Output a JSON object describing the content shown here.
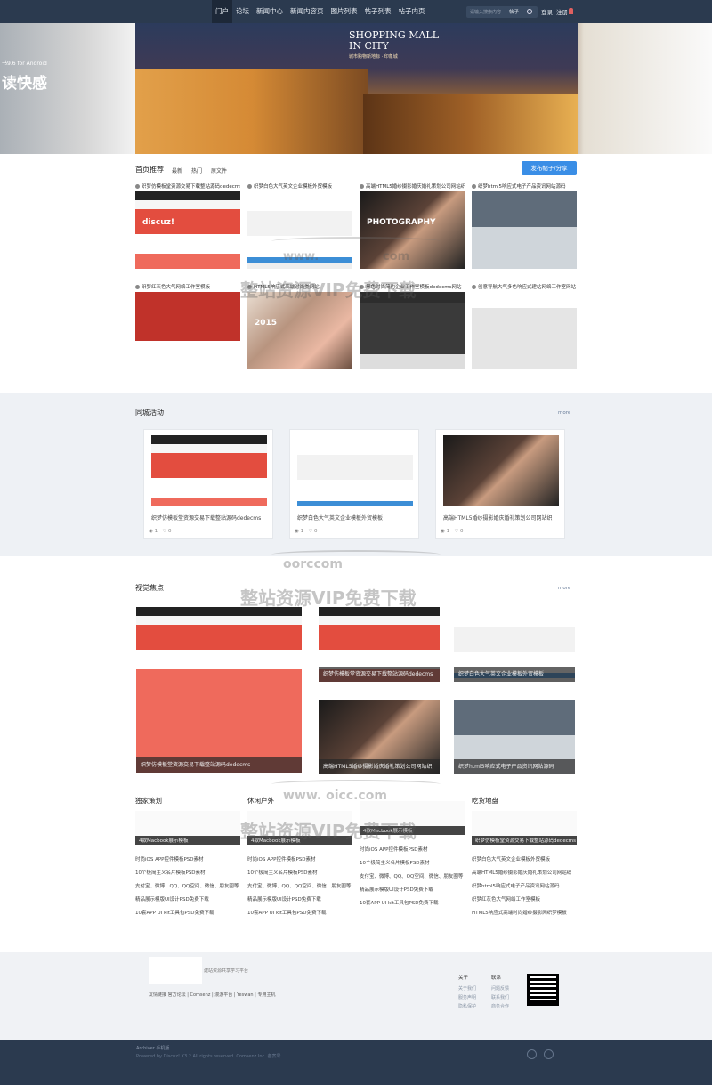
{
  "nav": {
    "items": [
      "门户",
      "论坛",
      "新闻中心",
      "新闻内容页",
      "图片列表",
      "帖子列表",
      "帖子内页"
    ],
    "active_index": 0,
    "search_placeholder": "请输入搜索内容",
    "search_type": "帖子",
    "login": "登录",
    "register": "注册"
  },
  "banner": {
    "left_line1": "书9.6 for Android",
    "left_line2": "读快感",
    "title_line1": "SHOPPING MALL",
    "title_line2": "IN CITY",
    "subtitle": "城市购物新地标 · 印象城"
  },
  "home": {
    "title": "首页推荐",
    "tabs": [
      "最新",
      "热门",
      "原文件"
    ],
    "post_button": "发布帖子/分享",
    "cards": [
      {
        "caption": "织梦仿模板堂资源交易下载整站源码dedecms",
        "style": "t-red",
        "label": "discuz!"
      },
      {
        "caption": "织梦白色大气英文企业模板外贸模板",
        "style": "t-white",
        "label": ""
      },
      {
        "caption": "高端HTML5婚纱摄影婚庆婚礼策划公司网站织",
        "style": "t-dark",
        "label": "PHOTOGRAPHY"
      },
      {
        "caption": "织梦html5响应式电子产品资讯网站源码",
        "style": "t-grey",
        "label": ""
      },
      {
        "caption": "织梦红灰色大气网络工作室模板",
        "style": "t-redbig",
        "label": ""
      },
      {
        "caption": "HTML5响应式高端时尚类网站",
        "style": "t-fashion",
        "label": "2015"
      },
      {
        "caption": "黑色时尚简约企业工作室模板dedecms网站",
        "style": "t-monitor",
        "label": ""
      },
      {
        "caption": "创意导航大气多色响应式建站网络工作室网站",
        "style": "t-phone",
        "label": ""
      }
    ]
  },
  "activity": {
    "title": "同城活动",
    "more": "more",
    "cards": [
      {
        "title": "织梦仿模板堂资源交易下载整站源码dedecms",
        "likes": "1",
        "comments": "0",
        "style": "t-red"
      },
      {
        "title": "织梦白色大气英文企业模板外贸模板",
        "likes": "1",
        "comments": "0",
        "style": "t-white"
      },
      {
        "title": "高端HTML5婚纱摄影婚庆婚礼策划公司网站织",
        "likes": "1",
        "comments": "0",
        "style": "t-dark"
      }
    ]
  },
  "visual": {
    "title": "视觉焦点",
    "more": "more",
    "tiles": [
      {
        "caption": "织梦仿模板堂资源交易下载整站源码dedecms",
        "style": "t-red"
      },
      {
        "caption": "织梦仿模板堂资源交易下载整站源码dedecms",
        "style": "t-red"
      },
      {
        "caption": "织梦白色大气英文企业模板外贸模板",
        "style": "t-white"
      },
      {
        "caption": "高端HTML5婚纱摄影婚庆婚礼策划公司网站织",
        "style": "t-dark"
      },
      {
        "caption": "织梦html5响应式电子产品资讯网站源码",
        "style": "t-grey"
      }
    ]
  },
  "columns": [
    {
      "title": "独家策划",
      "image_caption": "4款Macbook展示模板",
      "items": [
        "时尚iOS APP控件模板PSD素材",
        "10个极简主义名片模板PSD素材",
        "支付宝、微博、QQ、QQ空间、微信、朋友圈等",
        "精品展示模版UI设计PSD免费下载",
        "10套APP UI kit工具包PSD免费下载"
      ]
    },
    {
      "title": "休闲户外",
      "image_caption": "4款Macbook展示模板",
      "items": [
        "时尚iOS APP控件模板PSD素材",
        "10个极简主义名片模板PSD素材",
        "支付宝、微博、QQ、QQ空间、微信、朋友圈等",
        "精品展示模版UI设计PSD免费下载",
        "10套APP UI kit工具包PSD免费下载"
      ]
    },
    {
      "title": "",
      "image_caption": "4款Macbook展示模板",
      "items": [
        "时尚iOS APP控件模板PSD素材",
        "10个极简主义名片模板PSD素材",
        "支付宝、微博、QQ、QQ空间、微信、朋友圈等",
        "精品展示模版UI设计PSD免费下载",
        "10套APP UI kit工具包PSD免费下载"
      ]
    },
    {
      "title": "吃货地盘",
      "image_caption": "织梦仿模板堂资源交易下载整站源码dedecms",
      "items": [
        "织梦白色大气英文企业模板外贸模板",
        "高端HTML5婚纱摄影婚庆婚礼策划公司网站织",
        "织梦html5响应式电子产品资讯网站源码",
        "织梦红灰色大气网络工作室模板",
        "HTML5响应式高端时尚婚纱摄影网织梦模板"
      ]
    }
  ],
  "footer": {
    "desc": "建站资源共享学习平台",
    "links_label": "友情链接",
    "links": [
      "官方论坛",
      "Comsenz",
      "漫游平台",
      "Yeswan",
      "专用主机"
    ],
    "about_title": "关于",
    "about_items": [
      "关于我们",
      "服务声明",
      "隐私保护"
    ],
    "contact_title": "联系",
    "contact_items": [
      "问题反馈",
      "联系我们",
      "商务合作"
    ]
  },
  "bottom": {
    "line1": "Archiver   手机版",
    "line2": "Powered by Discuz! X3.2  All rights reserved. Comsenz Inc.  备案号"
  },
  "watermark": {
    "url1": "www.",
    "url2": "com",
    "url_short": "oorccom",
    "text": "整站资源VIP免费下载",
    "url_full": "www.  oicc.com"
  }
}
